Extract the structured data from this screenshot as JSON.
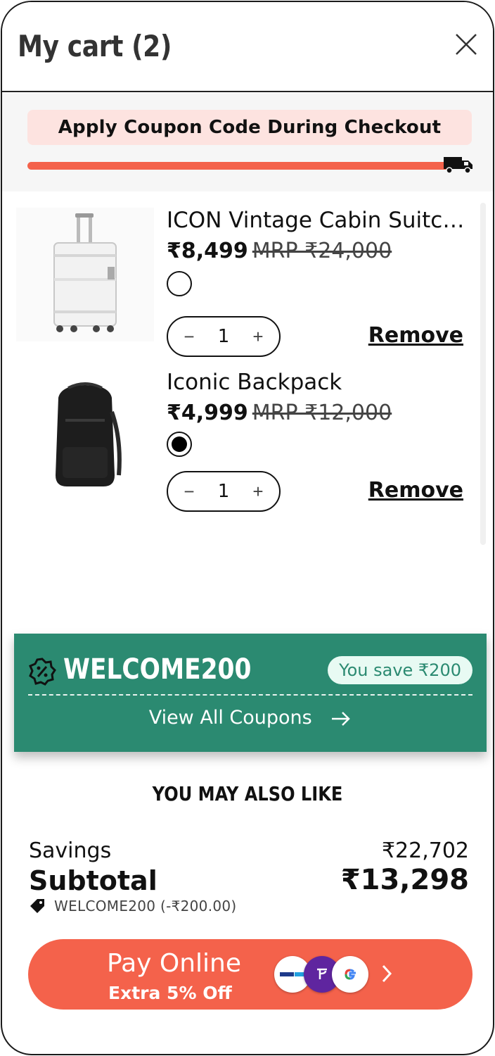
{
  "header": {
    "title": "My cart (2)"
  },
  "banner": {
    "text": "Apply Coupon Code During Checkout",
    "progress": 1.0
  },
  "items": [
    {
      "name": "ICON Vintage Cabin Suitc…",
      "price": "₹8,499",
      "mrp": "MRP ₹24,000",
      "color": "white",
      "qty": "1",
      "remove": "Remove"
    },
    {
      "name": "Iconic Backpack",
      "price": "₹4,999",
      "mrp": "MRP ₹12,000",
      "color": "black",
      "qty": "1",
      "remove": "Remove"
    }
  ],
  "coupon": {
    "code": "WELCOME200",
    "saving": "You save ₹200",
    "view_all": "View All Coupons"
  },
  "recommendations": {
    "title": "YOU MAY ALSO LIKE"
  },
  "totals": {
    "savings_label": "Savings",
    "savings_value": "₹22,702",
    "subtotal_label": "Subtotal",
    "subtotal_value": "₹13,298",
    "applied_code": "WELCOME200 (-₹200.00)"
  },
  "pay": {
    "title": "Pay Online",
    "subtitle": "Extra 5% Off",
    "logos": [
      "paytm-logo",
      "phonepe-logo",
      "gpay-logo"
    ]
  },
  "colors": {
    "accent": "#f4624b",
    "coupon_green": "#2b8a71",
    "banner_pink": "#fde3e0"
  }
}
